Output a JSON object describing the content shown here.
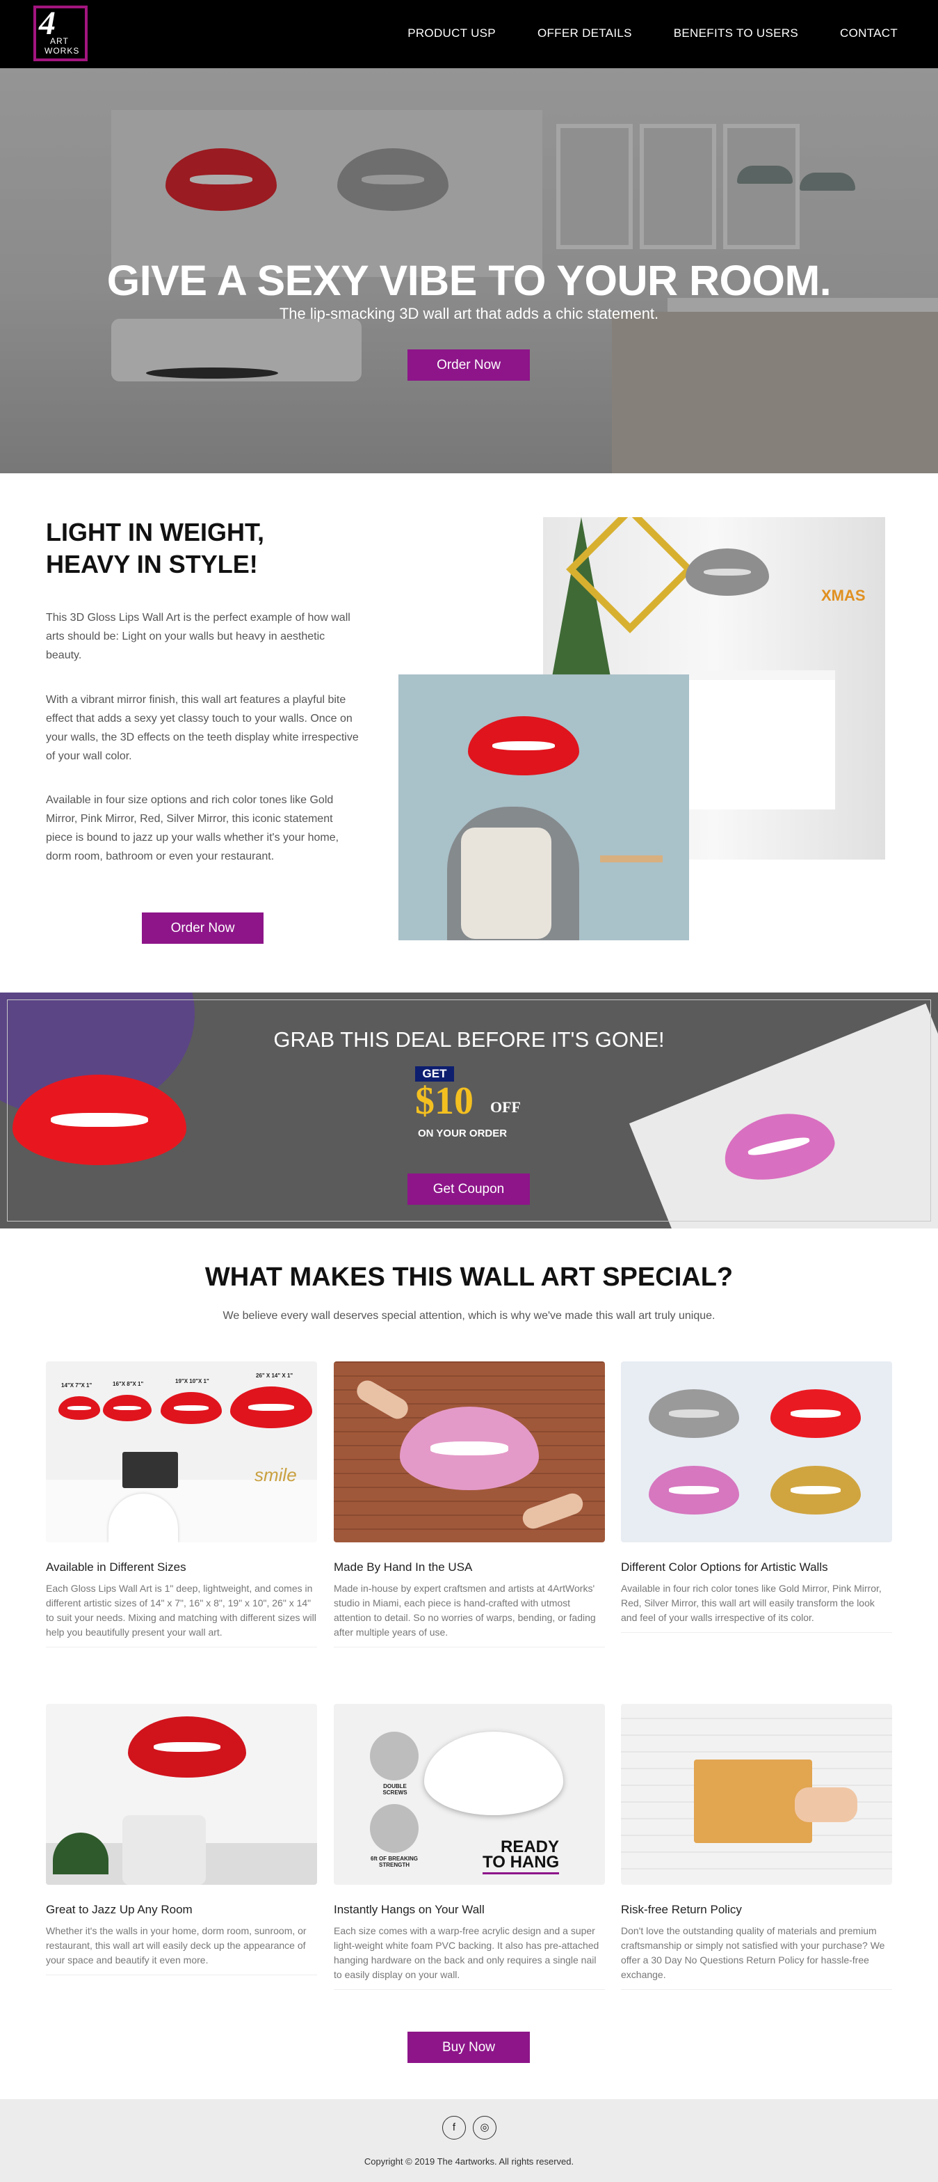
{
  "nav": {
    "logo_number": "4",
    "logo_word1": "ART",
    "logo_word2": "WORKS",
    "items": [
      "PRODUCT USP",
      "OFFER DETAILS",
      "BENEFITS TO USERS",
      "CONTACT"
    ]
  },
  "hero": {
    "title": "GIVE A SEXY VIBE TO YOUR ROOM.",
    "subtitle": "The lip-smacking 3D wall art that adds a chic statement.",
    "button": "Order Now"
  },
  "feature": {
    "title_line1": "LIGHT IN WEIGHT,",
    "title_line2": "HEAVY IN STYLE!",
    "paragraphs": [
      "This 3D Gloss Lips Wall Art is the perfect example of how wall arts should be: Light on your walls but heavy in aesthetic beauty.",
      "With a vibrant mirror finish, this wall art features a playful bite effect that adds a sexy yet classy touch to your walls. Once on your walls, the 3D effects on the teeth display white irrespective of your wall color.",
      "Available in four size options and rich color tones like Gold Mirror, Pink Mirror, Red, Silver Mirror, this iconic statement piece is bound to jazz up your walls whether it's your home, dorm room, bathroom or even your restaurant."
    ],
    "button": "Order Now",
    "xmas_label": "XMAS"
  },
  "deal": {
    "title": "GRAB THIS DEAL BEFORE IT'S GONE!",
    "get": "GET",
    "amount": "$10",
    "off": "OFF",
    "on_order": "ON YOUR ORDER",
    "button": "Get Coupon"
  },
  "special": {
    "title": "WHAT MAKES THIS WALL ART SPECIAL?",
    "subtitle": "We believe every wall deserves special attention, which is why we've made this wall art truly unique.",
    "cards": [
      {
        "title": "Available in Different Sizes",
        "desc": "Each Gloss Lips Wall Art is 1\" deep, lightweight, and comes in different artistic sizes of 14\" x 7\", 16\" x 8\", 19\" x 10\", 26\" x 14\" to suit your needs. Mixing and matching with different sizes will help you beautifully present your wall art.",
        "sizes": [
          "14\"X 7\"X 1\"",
          "16\"X 8\"X 1\"",
          "19\"X 10\"X 1\"",
          "26\" X 14\" X 1\""
        ],
        "smile": "smile"
      },
      {
        "title": "Made By Hand In the USA",
        "desc": "Made in-house by expert craftsmen and artists at 4ArtWorks' studio in Miami, each piece is hand-crafted with utmost attention to detail. So no worries of warps, bending, or fading after multiple years of use."
      },
      {
        "title": "Different Color Options for Artistic Walls",
        "desc": "Available in four rich color tones like Gold Mirror, Pink Mirror, Red, Silver Mirror, this wall art will easily transform the look and feel of your walls irrespective of its color."
      },
      {
        "title": "Great to Jazz Up Any Room",
        "desc": "Whether it's the walls in your home, dorm room, sunroom, or restaurant, this wall art will easily deck up the appearance of your space and beautify it even more."
      },
      {
        "title": "Instantly Hangs on Your Wall",
        "desc": "Each size comes with a warp-free acrylic design and a super light-weight white foam PVC backing. It also has pre-attached hanging hardware on the back and only requires a single nail to easily display on your wall.",
        "label1": "DOUBLE SCREWS",
        "label2": "6ft OF BREAKING STRENGTH",
        "ready1": "READY",
        "ready2": "TO HANG"
      },
      {
        "title": "Risk-free Return Policy",
        "desc": "Don't love the outstanding quality of materials and premium craftsmanship or simply not satisfied with your purchase? We offer a 30 Day No Questions Return Policy for hassle-free exchange."
      }
    ],
    "button": "Buy Now"
  },
  "footer": {
    "facebook": "f",
    "instagram": "◎",
    "copyright": "Copyright © 2019 The 4artworks. All rights reserved."
  }
}
